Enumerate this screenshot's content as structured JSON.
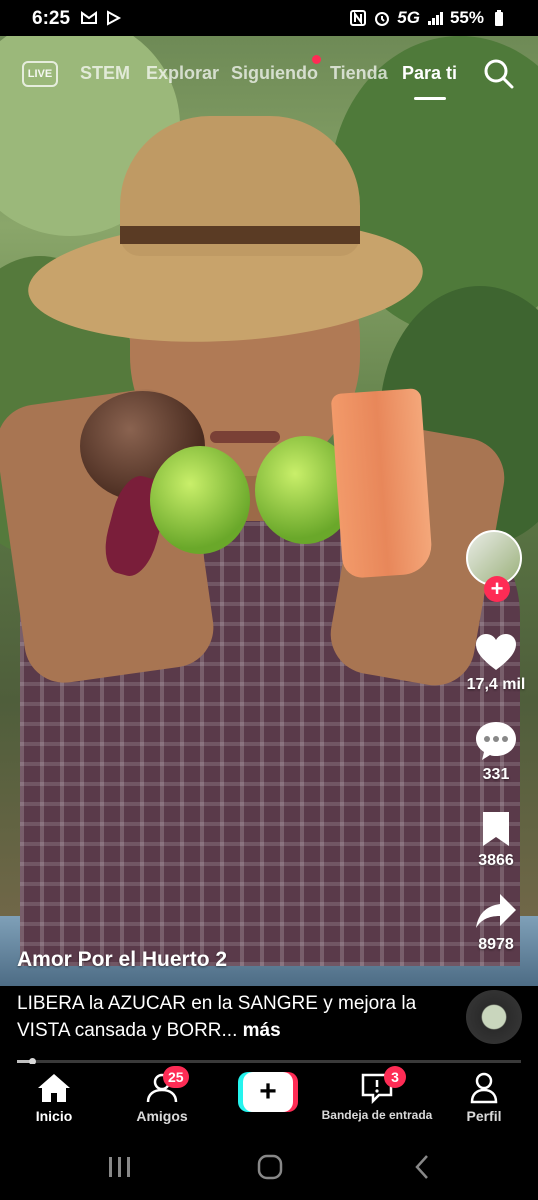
{
  "status_bar": {
    "time": "6:25",
    "network": "5G",
    "battery": "55%",
    "left_icons": [
      "gmail-icon",
      "play-icon"
    ],
    "right_icons": [
      "nfc-icon",
      "alarm-icon",
      "signal-icon",
      "battery-icon"
    ]
  },
  "top_nav": {
    "live_label": "LIVE",
    "tabs": [
      {
        "label": "STEM",
        "active": false
      },
      {
        "label": "Explorar",
        "active": false
      },
      {
        "label": "Siguiendo",
        "active": false
      },
      {
        "label": "Tienda",
        "active": false
      },
      {
        "label": "Para ti",
        "active": true
      }
    ]
  },
  "actions": {
    "likes": "17,4 mil",
    "comments": "331",
    "saves": "3866",
    "shares": "8978"
  },
  "post": {
    "author": "Amor Por el Huerto 2",
    "caption": "LIBERA la AZUCAR  en la SANGRE y mejora la VISTA cansada y BORR...",
    "more": "más",
    "progress": 0.03
  },
  "tabbar": {
    "home": "Inicio",
    "friends": "Amigos",
    "friends_badge": "25",
    "create": "+",
    "inbox": "Bandeja de entrada",
    "inbox_badge": "3",
    "profile": "Perfil"
  },
  "colors": {
    "accent": "#fe2c55",
    "create_left": "#25f4ee"
  }
}
